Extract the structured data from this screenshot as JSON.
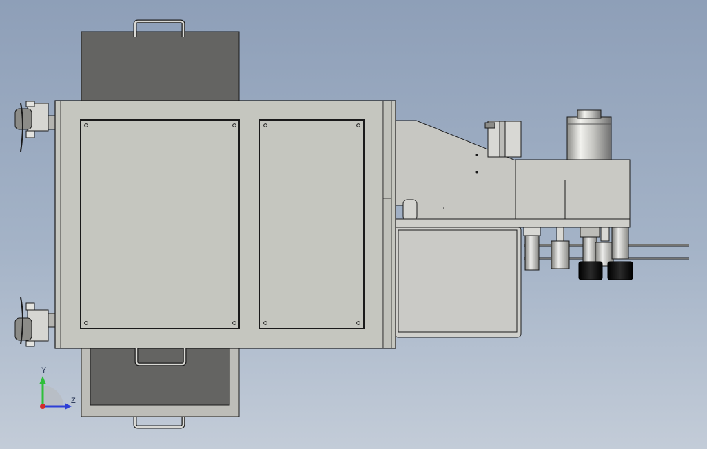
{
  "viewport": {
    "background_top": "#8e9fb8",
    "background_bottom": "#c3ccd8"
  },
  "colors": {
    "outline": "#1a1a1a",
    "panel": "#c5c6bf",
    "tray_dark": "#646462",
    "housing": "#d0d0cc",
    "knob_black": "#141414",
    "metal_light": "#e6e6e2",
    "metal_mid": "#a6a6a2"
  },
  "triad": {
    "y_label": "Y",
    "z_label": "Z",
    "y_axis_color": "#2fbf3a",
    "z_axis_color": "#2e3fd6",
    "origin_color": "#d22c2c"
  },
  "parts": {
    "main_cabinet": "main-cabinet",
    "left_door": "left-access-panel",
    "right_door": "right-access-panel",
    "top_tray": "top-tray",
    "bottom_tray": "bottom-drawer",
    "casters": [
      "caster-top",
      "caster-bottom"
    ],
    "handles": [
      "handle-top",
      "handle-middle",
      "handle-bottom"
    ],
    "slanted_arm": "slanted-arm-housing",
    "cylinder": "vertical-cylinder",
    "lower_housing": "lower-housing-box",
    "knobs": [
      "knob-left",
      "knob-right"
    ],
    "rods": [
      "guide-rod-upper",
      "guide-rod-lower"
    ]
  }
}
